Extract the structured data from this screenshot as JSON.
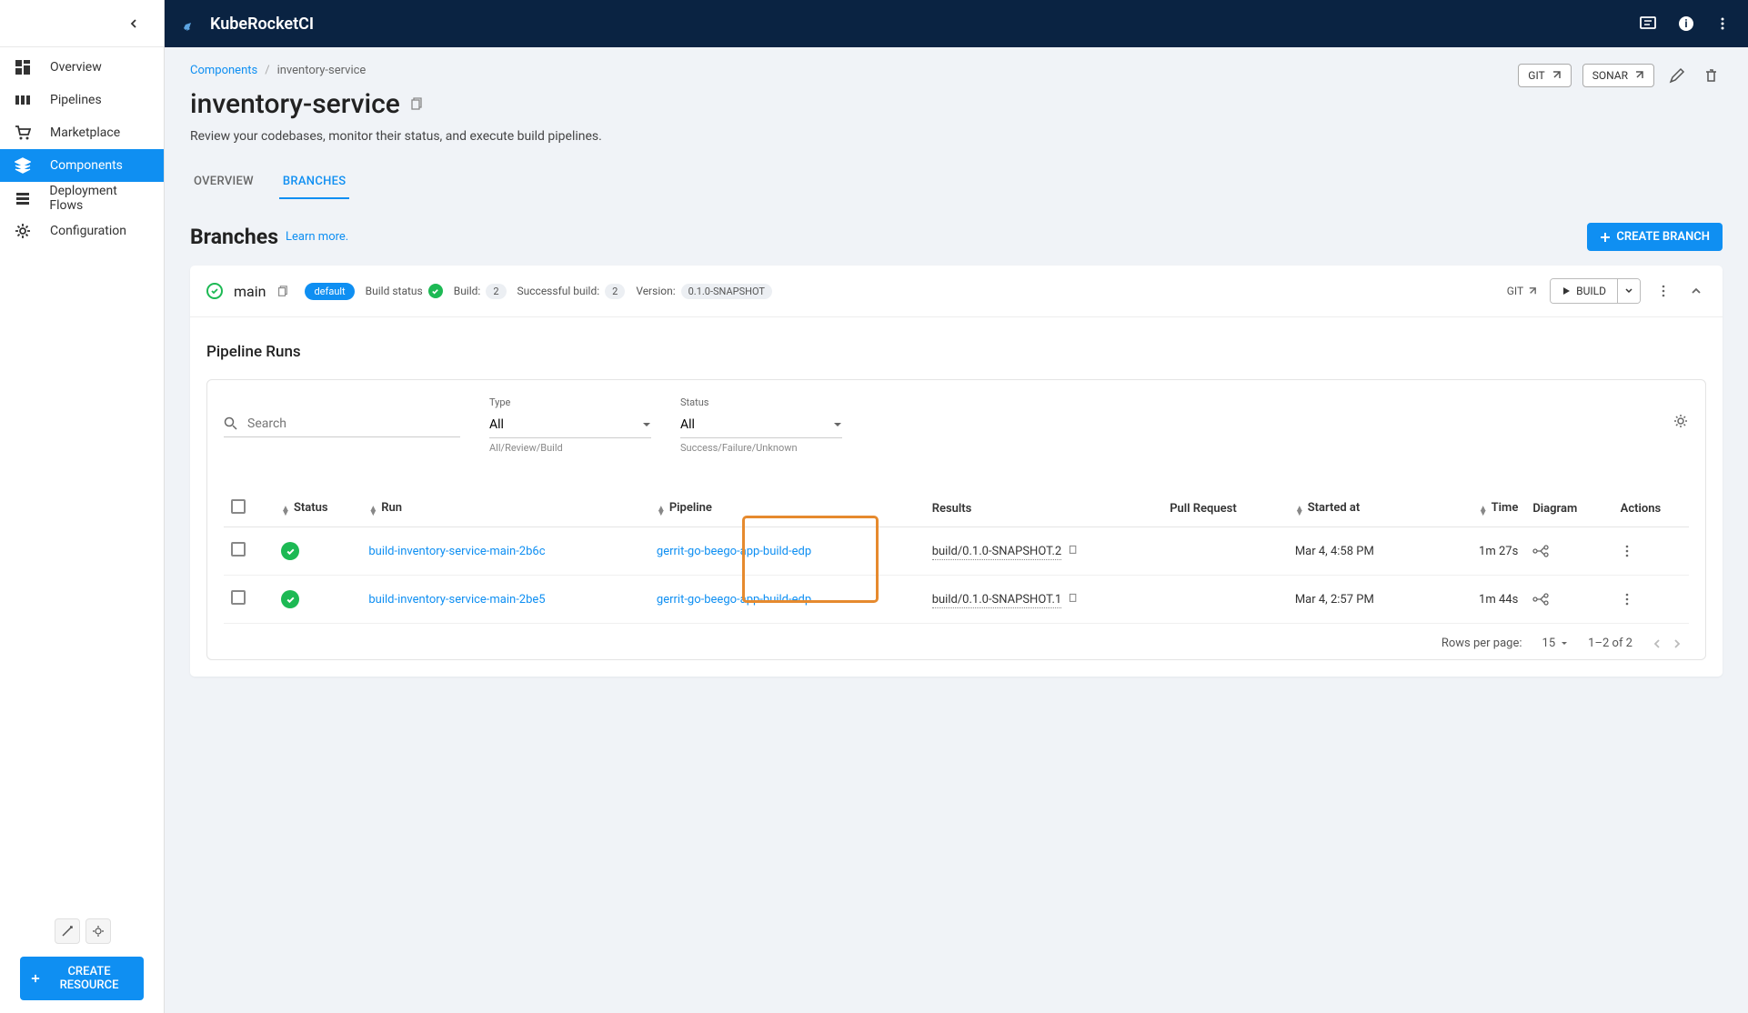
{
  "brand": "KubeRocketCI",
  "sidebar": {
    "items": [
      {
        "label": "Overview"
      },
      {
        "label": "Pipelines"
      },
      {
        "label": "Marketplace"
      },
      {
        "label": "Components"
      },
      {
        "label": "Deployment Flows"
      },
      {
        "label": "Configuration"
      }
    ],
    "create_button": "CREATE RESOURCE"
  },
  "breadcrumb": {
    "root": "Components",
    "current": "inventory-service"
  },
  "page": {
    "title": "inventory-service",
    "subtitle": "Review your codebases, monitor their status, and execute build pipelines."
  },
  "header_actions": {
    "git": "GIT",
    "sonar": "SONAR"
  },
  "tabs": {
    "overview": "OVERVIEW",
    "branches": "BRANCHES"
  },
  "branches_section": {
    "title": "Branches",
    "learn_more": "Learn more.",
    "create_button": "CREATE BRANCH"
  },
  "branch": {
    "name": "main",
    "default_chip": "default",
    "build_status_label": "Build status",
    "build_label": "Build:",
    "build_count": "2",
    "success_label": "Successful build:",
    "success_count": "2",
    "version_label": "Version:",
    "version_value": "0.1.0-SNAPSHOT",
    "git_link": "GIT",
    "build_button": "BUILD"
  },
  "pipeline_runs": {
    "title": "Pipeline Runs",
    "search_placeholder": "Search",
    "type_label": "Type",
    "type_value": "All",
    "type_hint": "All/Review/Build",
    "status_label": "Status",
    "status_value": "All",
    "status_hint": "Success/Failure/Unknown",
    "columns": {
      "status": "Status",
      "run": "Run",
      "pipeline": "Pipeline",
      "results": "Results",
      "pull_request": "Pull Request",
      "started_at": "Started at",
      "time": "Time",
      "diagram": "Diagram",
      "actions": "Actions"
    },
    "rows": [
      {
        "run": "build-inventory-service-main-2b6c",
        "pipeline": "gerrit-go-beego-app-build-edp",
        "result": "build/0.1.0-SNAPSHOT.2",
        "started": "Mar 4, 4:58 PM",
        "time": "1m 27s"
      },
      {
        "run": "build-inventory-service-main-2be5",
        "pipeline": "gerrit-go-beego-app-build-edp",
        "result": "build/0.1.0-SNAPSHOT.1",
        "started": "Mar 4, 2:57 PM",
        "time": "1m 44s"
      }
    ],
    "pagination": {
      "rows_label": "Rows per page:",
      "rows_value": "15",
      "range": "1–2 of 2"
    }
  }
}
